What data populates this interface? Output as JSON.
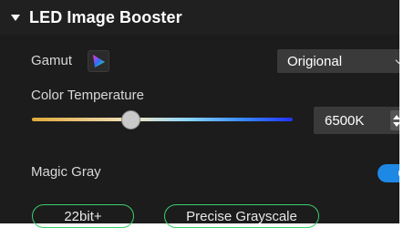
{
  "section": {
    "title": "LED Image Booster"
  },
  "gamut": {
    "label": "Gamut",
    "icon": "color-gamut-icon",
    "selected": "Origional"
  },
  "color_temperature": {
    "label": "Color Temperature",
    "value": "6500K",
    "slider_fraction": 0.37
  },
  "magic_gray": {
    "label": "Magic Gray",
    "enabled": true
  },
  "chips": {
    "bit": "22bit+",
    "grayscale": "Precise Grayscale"
  },
  "colors": {
    "background": "#1c1c1c",
    "accent_blue": "#1e88e5",
    "chip_border": "#3ccf6c"
  }
}
